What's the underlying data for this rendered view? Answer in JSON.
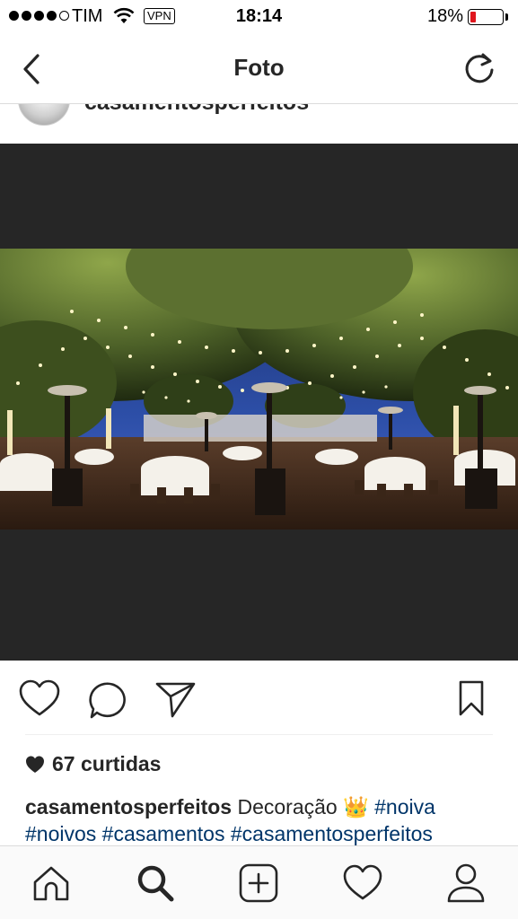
{
  "status_bar": {
    "carrier": "TIM",
    "vpn": "VPN",
    "time": "18:14",
    "battery_percent": "18%",
    "battery_level": 0.18,
    "battery_color": "#e0161e"
  },
  "nav": {
    "title": "Foto",
    "back_icon": "chevron-left-icon",
    "refresh_icon": "refresh-icon"
  },
  "post": {
    "username": "casamentosperfeitos",
    "image_alt": "Outdoor wedding reception at night with string lights under trees",
    "likes": "67 curtidas",
    "caption": {
      "username": "casamentosperfeitos",
      "text": "Decoração",
      "emoji": "👑",
      "hashtag_1": "#noiva",
      "hashtag_2": "#noivos",
      "hashtag_3": "#casamentos",
      "hashtag_4": "#casamentosperfeitos"
    }
  },
  "actions": {
    "like_icon": "heart-icon",
    "comment_icon": "comment-icon",
    "share_icon": "send-icon",
    "save_icon": "bookmark-icon"
  },
  "tab_bar": {
    "items": [
      "home-icon",
      "search-icon",
      "add-post-icon",
      "activity-heart-icon",
      "profile-icon"
    ]
  },
  "colors": {
    "hashtag": "#003569",
    "photo_background": "#262626",
    "text": "#262626"
  }
}
